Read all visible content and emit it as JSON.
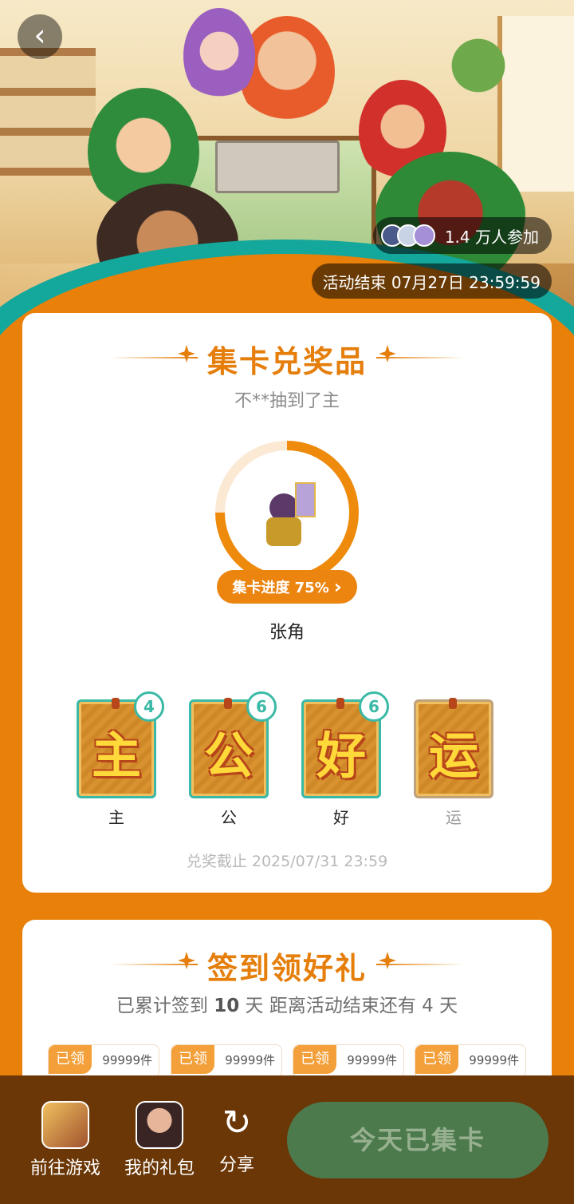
{
  "hero": {
    "back_label": "‹",
    "participants": "1.4 万人参加",
    "end_time": "活动结束 07月27日 23:59:59"
  },
  "collect": {
    "title": "集卡兑奖品",
    "subtitle": "不**抽到了主",
    "progress_percent": 75,
    "progress_label": "集卡进度 75%",
    "progress_chevron": "›",
    "character_name": "张角",
    "cards": [
      {
        "char": "主",
        "label": "主",
        "count": "4",
        "owned": true
      },
      {
        "char": "公",
        "label": "公",
        "count": "6",
        "owned": true
      },
      {
        "char": "好",
        "label": "好",
        "count": "6",
        "owned": true
      },
      {
        "char": "运",
        "label": "运",
        "count": "",
        "owned": false
      }
    ],
    "deadline": "兑奖截止 2025/07/31 23:59"
  },
  "signin": {
    "title": "签到领好礼",
    "sub_prefix": "已累计签到",
    "days": "10",
    "sub_mid": "天  距离活动结束还有",
    "remain": "4",
    "sub_suffix": "天",
    "chips": [
      {
        "tag": "已领",
        "num": "99999件"
      },
      {
        "tag": "已领",
        "num": "99999件"
      },
      {
        "tag": "已领",
        "num": "99999件"
      },
      {
        "tag": "已领",
        "num": "99999件"
      }
    ]
  },
  "bottom": {
    "goto_game": "前往游戏",
    "my_gift": "我的礼包",
    "share": "分享",
    "share_icon": "↻",
    "collect_btn": "今天已集卡"
  },
  "colors": {
    "accent": "#e57e0b",
    "page_bg": "#e8800a",
    "teal": "#39b9a6",
    "bottom_bar": "#6b3706",
    "collect_btn": "#4c7a4d"
  }
}
